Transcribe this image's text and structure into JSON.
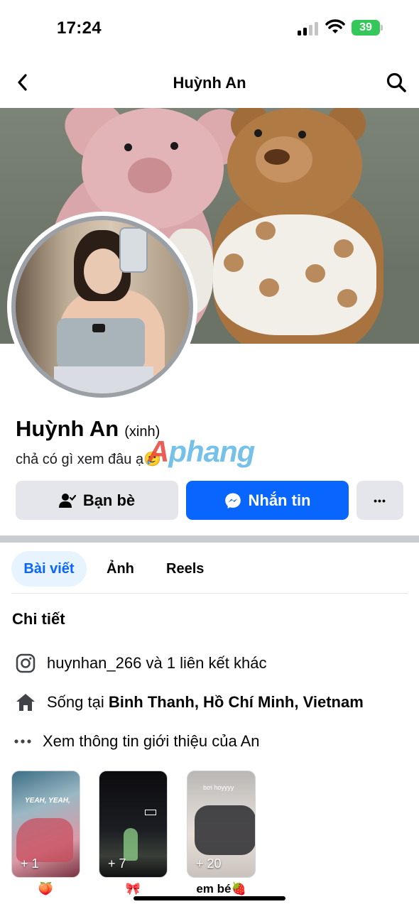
{
  "status_bar": {
    "time": "17:24",
    "battery": "39"
  },
  "nav": {
    "title": "Huỳnh An"
  },
  "profile": {
    "name": "Huỳnh An",
    "nickname": "(xinh)",
    "bio": "chả có gì xem đâu ạ🥲",
    "watermark": "Aphang"
  },
  "actions": {
    "friends_label": "Bạn bè",
    "message_label": "Nhắn tin",
    "more_label": "•••"
  },
  "tabs": [
    {
      "label": "Bài viết",
      "active": true
    },
    {
      "label": "Ảnh",
      "active": false
    },
    {
      "label": "Reels",
      "active": false
    }
  ],
  "details": {
    "title": "Chi tiết",
    "instagram": "huynhan_266 và 1 liên kết khác",
    "lives_prefix": "Sống tại ",
    "lives_place": "Binh Thanh, Hồ Chí Minh, Vietnam",
    "about_link": "Xem thông tin giới thiệu của An"
  },
  "highlights": [
    {
      "count": "+ 1",
      "label": "🍑",
      "inner_text": "YEAH, YEAH,"
    },
    {
      "count": "+ 7",
      "label": "🎀",
      "inner_text": ""
    },
    {
      "count": "+ 20",
      "label": "em bé🍓",
      "inner_text": "bơi hoyyyy"
    }
  ],
  "colors": {
    "accent": "#0866ff",
    "button_gray": "#e4e6eb",
    "active_tab_bg": "#e7f3ff",
    "battery": "#34c759"
  },
  "icons": {
    "back": "chevron-left-icon",
    "search": "search-icon",
    "friends": "person-check-icon",
    "message": "messenger-icon",
    "instagram": "instagram-icon",
    "home": "home-icon",
    "more": "ellipsis-icon"
  }
}
